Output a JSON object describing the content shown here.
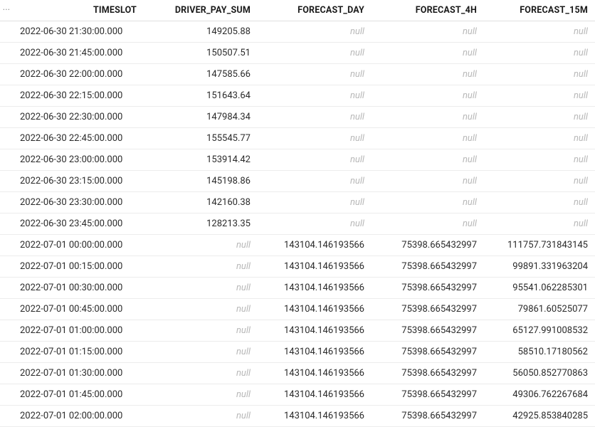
{
  "headers": {
    "menu": "···",
    "timeslot": "TIMESLOT",
    "driver_pay_sum": "DRIVER_PAY_SUM",
    "forecast_day": "FORECAST_DAY",
    "forecast_4h": "FORECAST_4H",
    "forecast_15m": "FORECAST_15M"
  },
  "null_label": "null",
  "rows": [
    {
      "timeslot": "2022-06-30 21:30:00.000",
      "driver_pay_sum": "149205.88",
      "forecast_day": null,
      "forecast_4h": null,
      "forecast_15m": null
    },
    {
      "timeslot": "2022-06-30 21:45:00.000",
      "driver_pay_sum": "150507.51",
      "forecast_day": null,
      "forecast_4h": null,
      "forecast_15m": null
    },
    {
      "timeslot": "2022-06-30 22:00:00.000",
      "driver_pay_sum": "147585.66",
      "forecast_day": null,
      "forecast_4h": null,
      "forecast_15m": null
    },
    {
      "timeslot": "2022-06-30 22:15:00.000",
      "driver_pay_sum": "151643.64",
      "forecast_day": null,
      "forecast_4h": null,
      "forecast_15m": null
    },
    {
      "timeslot": "2022-06-30 22:30:00.000",
      "driver_pay_sum": "147984.34",
      "forecast_day": null,
      "forecast_4h": null,
      "forecast_15m": null
    },
    {
      "timeslot": "2022-06-30 22:45:00.000",
      "driver_pay_sum": "155545.77",
      "forecast_day": null,
      "forecast_4h": null,
      "forecast_15m": null
    },
    {
      "timeslot": "2022-06-30 23:00:00.000",
      "driver_pay_sum": "153914.42",
      "forecast_day": null,
      "forecast_4h": null,
      "forecast_15m": null
    },
    {
      "timeslot": "2022-06-30 23:15:00.000",
      "driver_pay_sum": "145198.86",
      "forecast_day": null,
      "forecast_4h": null,
      "forecast_15m": null
    },
    {
      "timeslot": "2022-06-30 23:30:00.000",
      "driver_pay_sum": "142160.38",
      "forecast_day": null,
      "forecast_4h": null,
      "forecast_15m": null
    },
    {
      "timeslot": "2022-06-30 23:45:00.000",
      "driver_pay_sum": "128213.35",
      "forecast_day": null,
      "forecast_4h": null,
      "forecast_15m": null
    },
    {
      "timeslot": "2022-07-01 00:00:00.000",
      "driver_pay_sum": null,
      "forecast_day": "143104.146193566",
      "forecast_4h": "75398.665432997",
      "forecast_15m": "111757.731843145"
    },
    {
      "timeslot": "2022-07-01 00:15:00.000",
      "driver_pay_sum": null,
      "forecast_day": "143104.146193566",
      "forecast_4h": "75398.665432997",
      "forecast_15m": "99891.331963204"
    },
    {
      "timeslot": "2022-07-01 00:30:00.000",
      "driver_pay_sum": null,
      "forecast_day": "143104.146193566",
      "forecast_4h": "75398.665432997",
      "forecast_15m": "95541.062285301"
    },
    {
      "timeslot": "2022-07-01 00:45:00.000",
      "driver_pay_sum": null,
      "forecast_day": "143104.146193566",
      "forecast_4h": "75398.665432997",
      "forecast_15m": "79861.60525077"
    },
    {
      "timeslot": "2022-07-01 01:00:00.000",
      "driver_pay_sum": null,
      "forecast_day": "143104.146193566",
      "forecast_4h": "75398.665432997",
      "forecast_15m": "65127.991008532"
    },
    {
      "timeslot": "2022-07-01 01:15:00.000",
      "driver_pay_sum": null,
      "forecast_day": "143104.146193566",
      "forecast_4h": "75398.665432997",
      "forecast_15m": "58510.17180562"
    },
    {
      "timeslot": "2022-07-01 01:30:00.000",
      "driver_pay_sum": null,
      "forecast_day": "143104.146193566",
      "forecast_4h": "75398.665432997",
      "forecast_15m": "56050.852770863"
    },
    {
      "timeslot": "2022-07-01 01:45:00.000",
      "driver_pay_sum": null,
      "forecast_day": "143104.146193566",
      "forecast_4h": "75398.665432997",
      "forecast_15m": "49306.762267684"
    },
    {
      "timeslot": "2022-07-01 02:00:00.000",
      "driver_pay_sum": null,
      "forecast_day": "143104.146193566",
      "forecast_4h": "75398.665432997",
      "forecast_15m": "42925.853840285"
    }
  ]
}
